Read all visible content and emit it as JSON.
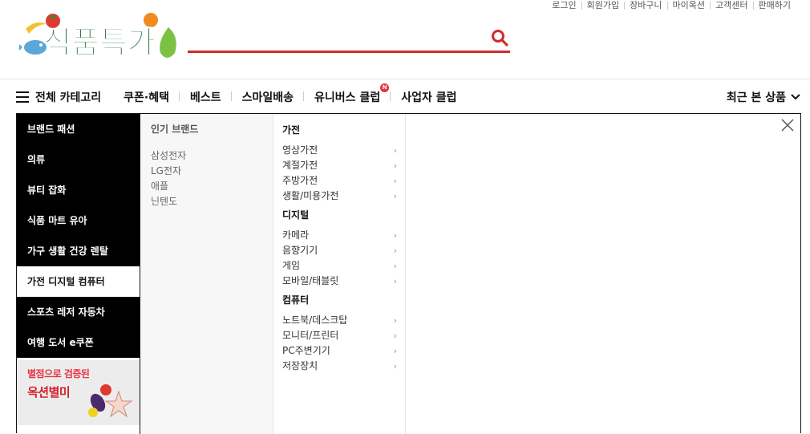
{
  "util_links": [
    "로그인",
    "회원가입",
    "장바구니",
    "마이옥션",
    "고객센터",
    "판매하기"
  ],
  "logo": {
    "text": "식품특가"
  },
  "search": {
    "placeholder": ""
  },
  "gnb": {
    "all_category": "전체 카테고리",
    "items": [
      {
        "label": "쿠폰·혜택"
      },
      {
        "label": "베스트"
      },
      {
        "label": "스마일배송"
      },
      {
        "label": "유니버스 클럽",
        "badge": "N"
      },
      {
        "label": "사업자 클럽"
      }
    ],
    "recent": "최근 본 상품"
  },
  "categories": [
    {
      "label": "브랜드 패션"
    },
    {
      "label": "의류"
    },
    {
      "label": "뷰티 잡화"
    },
    {
      "label": "식품 마트 유아"
    },
    {
      "label": "가구 생활 건강 렌탈"
    },
    {
      "label": "가전 디지털 컴퓨터",
      "active": true
    },
    {
      "label": "스포츠 레저 자동차"
    },
    {
      "label": "여행 도서 e쿠폰"
    }
  ],
  "promo": {
    "line1": "별점으로 검증된",
    "line2": "옥션별미"
  },
  "brands": {
    "title": "인기 브랜드",
    "items": [
      "삼성전자",
      "LG전자",
      "애플",
      "닌텐도"
    ]
  },
  "subcategories": [
    {
      "title": "가전",
      "items": [
        "영상가전",
        "계절가전",
        "주방가전",
        "생활/미용가전"
      ]
    },
    {
      "title": "디지털",
      "items": [
        "카메라",
        "음향기기",
        "게임",
        "모바일/태블릿"
      ]
    },
    {
      "title": "컴퓨터",
      "items": [
        "노트북/데스크탑",
        "모니터/프린터",
        "PC주변기기",
        "저장장치"
      ]
    }
  ],
  "colors": {
    "brand_red": "#d32b2b",
    "logo_green": "#1f6b3a",
    "menu_black": "#000000"
  }
}
